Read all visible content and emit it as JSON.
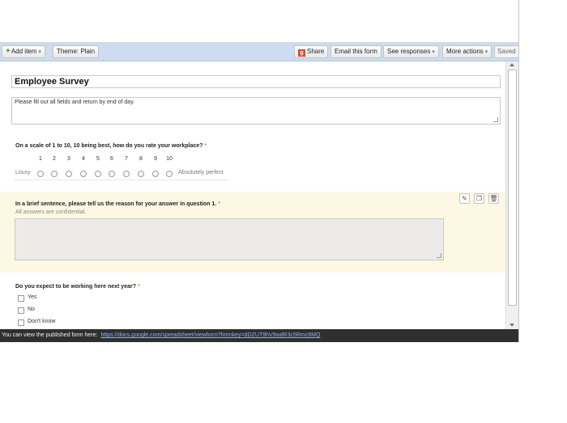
{
  "toolbar": {
    "add_item": "Add item",
    "theme": "Theme: Plain",
    "share": "Share",
    "email_form": "Email this form",
    "see_responses": "See responses",
    "more_actions": "More actions",
    "saved": "Saved"
  },
  "form": {
    "title": "Employee Survey",
    "description": "Please fill out all fields and return by end of day."
  },
  "q1": {
    "title": "On a scale of 1 to 10, 10 being best, how do you rate your workplace?",
    "required_mark": "*",
    "numbers": [
      "1",
      "2",
      "3",
      "4",
      "5",
      "6",
      "7",
      "8",
      "9",
      "10"
    ],
    "low_label": "Lousy",
    "high_label": "Absolutely perfect"
  },
  "q2": {
    "title": "In a brief sentence, please tell us the reason for your answer in question 1.",
    "required_mark": "*",
    "help": "All answers are confidential."
  },
  "q3": {
    "title": "Do you expect to be working here next year?",
    "required_mark": "*",
    "options": [
      "Yes",
      "No",
      "Don't know"
    ]
  },
  "status": {
    "label": "You can view the published form here:",
    "link": "https://docs.google.com/spreadsheet/viewform?formkey=dDZUT9hV9wdR3c5Rmc6MQ"
  },
  "colors": {
    "toolbar_bg": "#cddcf0",
    "highlight_bg": "#fdf8e3",
    "status_bg": "#2f2f2f",
    "link": "#8bb4ff"
  }
}
